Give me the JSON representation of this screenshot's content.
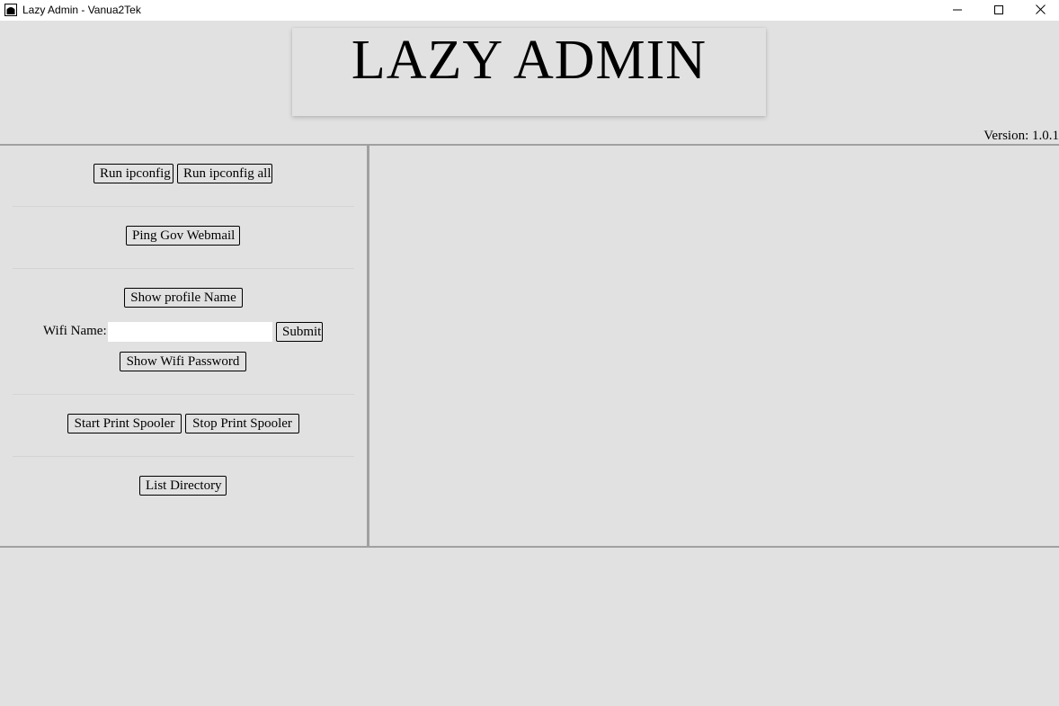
{
  "window": {
    "title": "Lazy Admin - Vanua2Tek"
  },
  "header": {
    "logo_text": "LAZY ADMIN",
    "version": "Version: 1.0.1"
  },
  "controls": {
    "run_ipconfig": "Run ipconfig",
    "run_ipconfig_all": "Run ipconfig all",
    "ping_gov_webmail": "Ping Gov Webmail",
    "show_profile_name": "Show profile Name",
    "wifi_name_label": "Wifi Name:",
    "wifi_name_value": "",
    "submit": "Submit",
    "show_wifi_password": "Show Wifi Password",
    "start_print_spooler": "Start Print Spooler",
    "stop_print_spooler": "Stop Print Spooler",
    "list_directory": "List Directory"
  },
  "output": {
    "text": ""
  },
  "colors": {
    "background": "#e1e1e1",
    "divider": "#a0a0a0",
    "button_border": "#000000"
  },
  "icons": [
    "app-icon",
    "minimize-icon",
    "maximize-icon",
    "close-icon"
  ]
}
